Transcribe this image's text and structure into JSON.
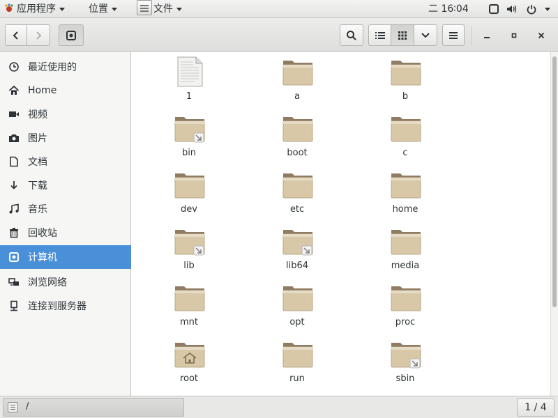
{
  "topbar": {
    "applications_label": "应用程序",
    "places_label": "位置",
    "files_label": "文件",
    "clock": "二 16∶04"
  },
  "sidebar": {
    "items": [
      {
        "label": "最近使用的",
        "icon": "clock-icon"
      },
      {
        "label": "Home",
        "icon": "home-icon"
      },
      {
        "label": "视频",
        "icon": "video-icon"
      },
      {
        "label": "图片",
        "icon": "camera-icon"
      },
      {
        "label": "文档",
        "icon": "document-icon"
      },
      {
        "label": "下载",
        "icon": "download-icon"
      },
      {
        "label": "音乐",
        "icon": "music-icon"
      },
      {
        "label": "回收站",
        "icon": "trash-icon"
      },
      {
        "label": "计算机",
        "icon": "computer-icon",
        "selected": true
      },
      {
        "label": "浏览网络",
        "icon": "network-icon"
      },
      {
        "label": "连接到服务器",
        "icon": "server-icon"
      }
    ]
  },
  "files": [
    {
      "name": "1",
      "type": "document"
    },
    {
      "name": "a",
      "type": "folder"
    },
    {
      "name": "b",
      "type": "folder"
    },
    {
      "name": "bin",
      "type": "symlink"
    },
    {
      "name": "boot",
      "type": "folder"
    },
    {
      "name": "c",
      "type": "folder"
    },
    {
      "name": "dev",
      "type": "folder"
    },
    {
      "name": "etc",
      "type": "folder"
    },
    {
      "name": "home",
      "type": "folder"
    },
    {
      "name": "lib",
      "type": "symlink"
    },
    {
      "name": "lib64",
      "type": "symlink"
    },
    {
      "name": "media",
      "type": "folder"
    },
    {
      "name": "mnt",
      "type": "folder"
    },
    {
      "name": "opt",
      "type": "folder"
    },
    {
      "name": "proc",
      "type": "folder"
    },
    {
      "name": "root",
      "type": "home-folder"
    },
    {
      "name": "run",
      "type": "folder"
    },
    {
      "name": "sbin",
      "type": "symlink"
    }
  ],
  "statusbar": {
    "path": "/",
    "page_indicator": "1 / 4"
  },
  "colors": {
    "selection": "#4a90d9",
    "folder_body": "#d8c8a8",
    "folder_tab": "#8f7c62"
  }
}
